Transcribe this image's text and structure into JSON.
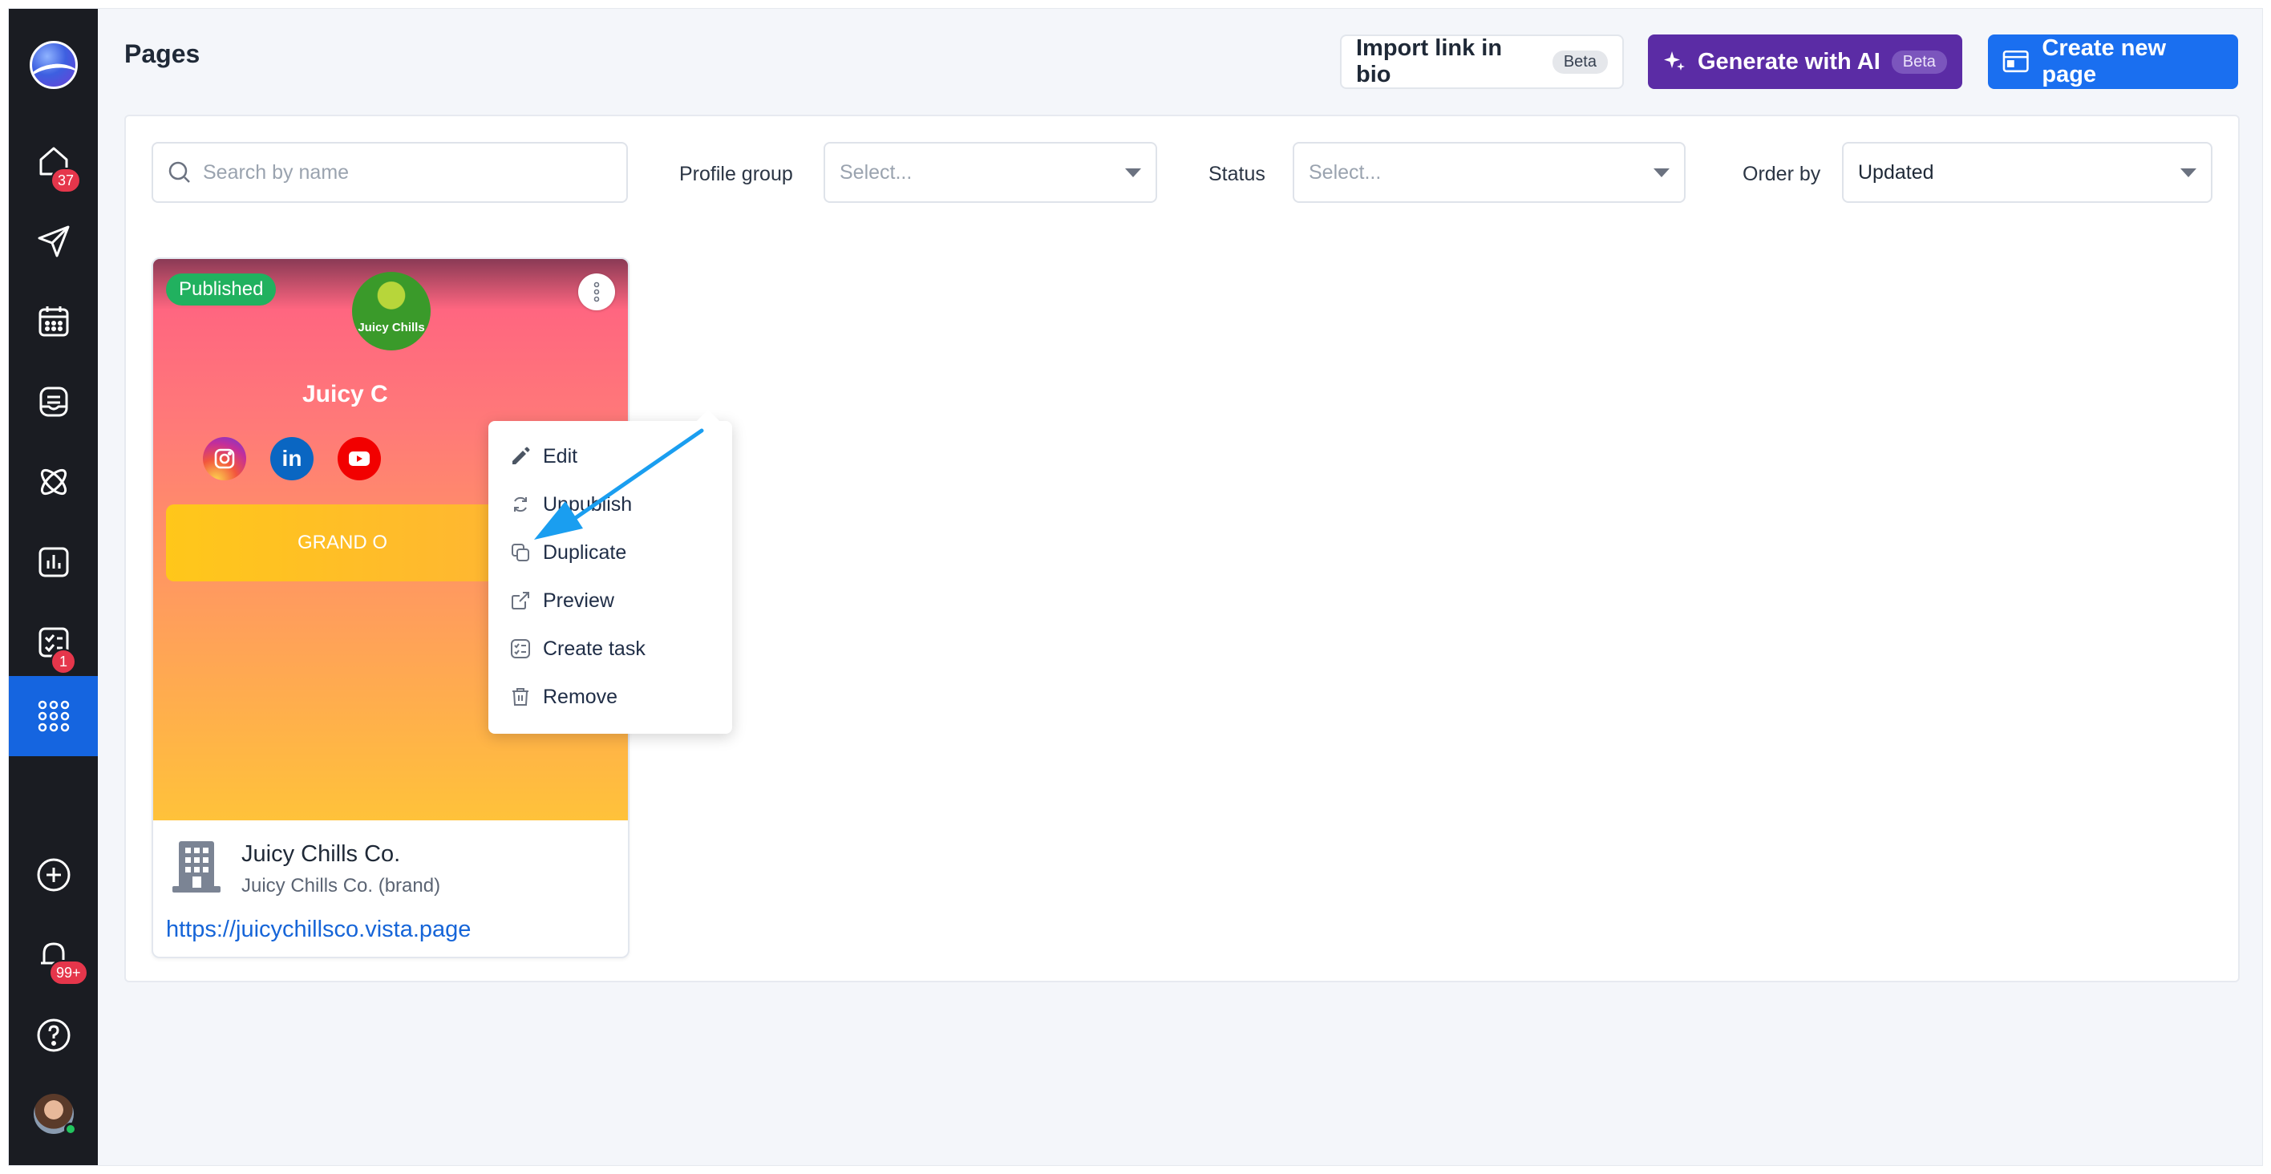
{
  "sidebar": {
    "badges": {
      "home": "37",
      "tasks": "1",
      "notifications": "99+"
    }
  },
  "header": {
    "title": "Pages",
    "import_label": "Import link in bio",
    "import_badge": "Beta",
    "ai_label": "Generate with AI",
    "ai_badge": "Beta",
    "create_label": "Create new page"
  },
  "filters": {
    "search_placeholder": "Search by name",
    "profile_group_label": "Profile group",
    "profile_group_value": "Select...",
    "status_label": "Status",
    "status_value": "Select...",
    "order_label": "Order by",
    "order_value": "Updated"
  },
  "card": {
    "status": "Published",
    "logo_text": "Juicy Chills",
    "preview_title": "Juicy C",
    "linkedin_glyph": "in",
    "button_text": "GRAND O",
    "name": "Juicy Chills Co.",
    "subtitle": "Juicy Chills Co. (brand)",
    "url": "https://juicychillsco.vista.page"
  },
  "menu": {
    "items": [
      {
        "label": "Edit",
        "icon": "pencil-icon"
      },
      {
        "label": "Unpublish",
        "icon": "refresh-icon"
      },
      {
        "label": "Duplicate",
        "icon": "duplicate-icon"
      },
      {
        "label": "Preview",
        "icon": "external-link-icon"
      },
      {
        "label": "Create task",
        "icon": "task-icon"
      },
      {
        "label": "Remove",
        "icon": "trash-icon"
      }
    ]
  },
  "colors": {
    "sidebar_bg": "#1a1c22",
    "sidebar_active": "#1565e0",
    "ai_button": "#5b2ca5",
    "primary_button": "#1a6ff0",
    "published_badge": "#21b15f",
    "arrow": "#1a9ef0"
  }
}
